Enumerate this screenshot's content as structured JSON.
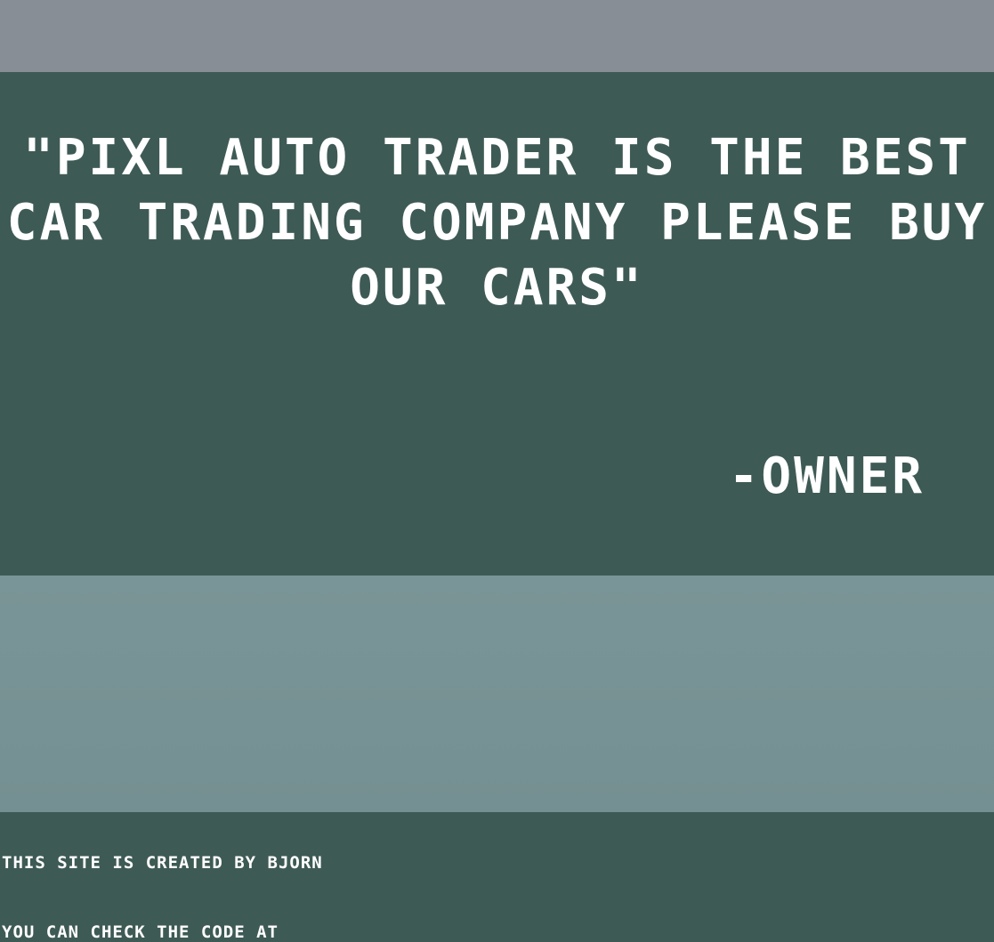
{
  "quote": {
    "text": "\"PIXL AUTO TRADER IS THE BEST CAR TRADING COMPANY PLEASE BUY OUR CARS\"",
    "author": "-OWNER"
  },
  "footer": {
    "credit": "THIS SITE IS CREATED BY BJORN",
    "code_note": "YOU CAN CHECK THE CODE AT"
  },
  "colors": {
    "top_band": "#878e96",
    "section_bg": "#3e5a55",
    "image_band": "#789395",
    "text": "#ffffff"
  }
}
